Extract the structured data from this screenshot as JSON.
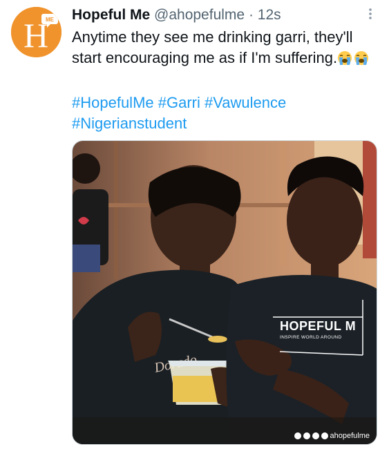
{
  "tweet": {
    "display_name": "Hopeful Me",
    "handle": "@ahopefulme",
    "separator": "·",
    "time": "12s",
    "text": "Anytime they see me drinking garri, they'll start encouraging me as if I'm suffering.",
    "emojis": [
      "loudly-crying-face",
      "loudly-crying-face"
    ],
    "hashtags": [
      "#HopefulMe",
      "#Garri",
      "#Vawulence",
      "#Nigerianstudent"
    ]
  },
  "avatar": {
    "logo_letter": "H",
    "logo_badge": "ME"
  },
  "media": {
    "shirt_brand": "HOPEFUL M",
    "shirt_tagline": "INSPIRE WORLD AROUND",
    "watermark_handle": "ahopefulme",
    "watermark_icons": [
      "facebook-icon",
      "twitter-icon",
      "instagram-icon",
      "linkedin-icon"
    ]
  },
  "colors": {
    "accent": "#1d9bf0",
    "avatar_bg": "#f0932c",
    "text": "#0f1419",
    "muted": "#536471"
  }
}
